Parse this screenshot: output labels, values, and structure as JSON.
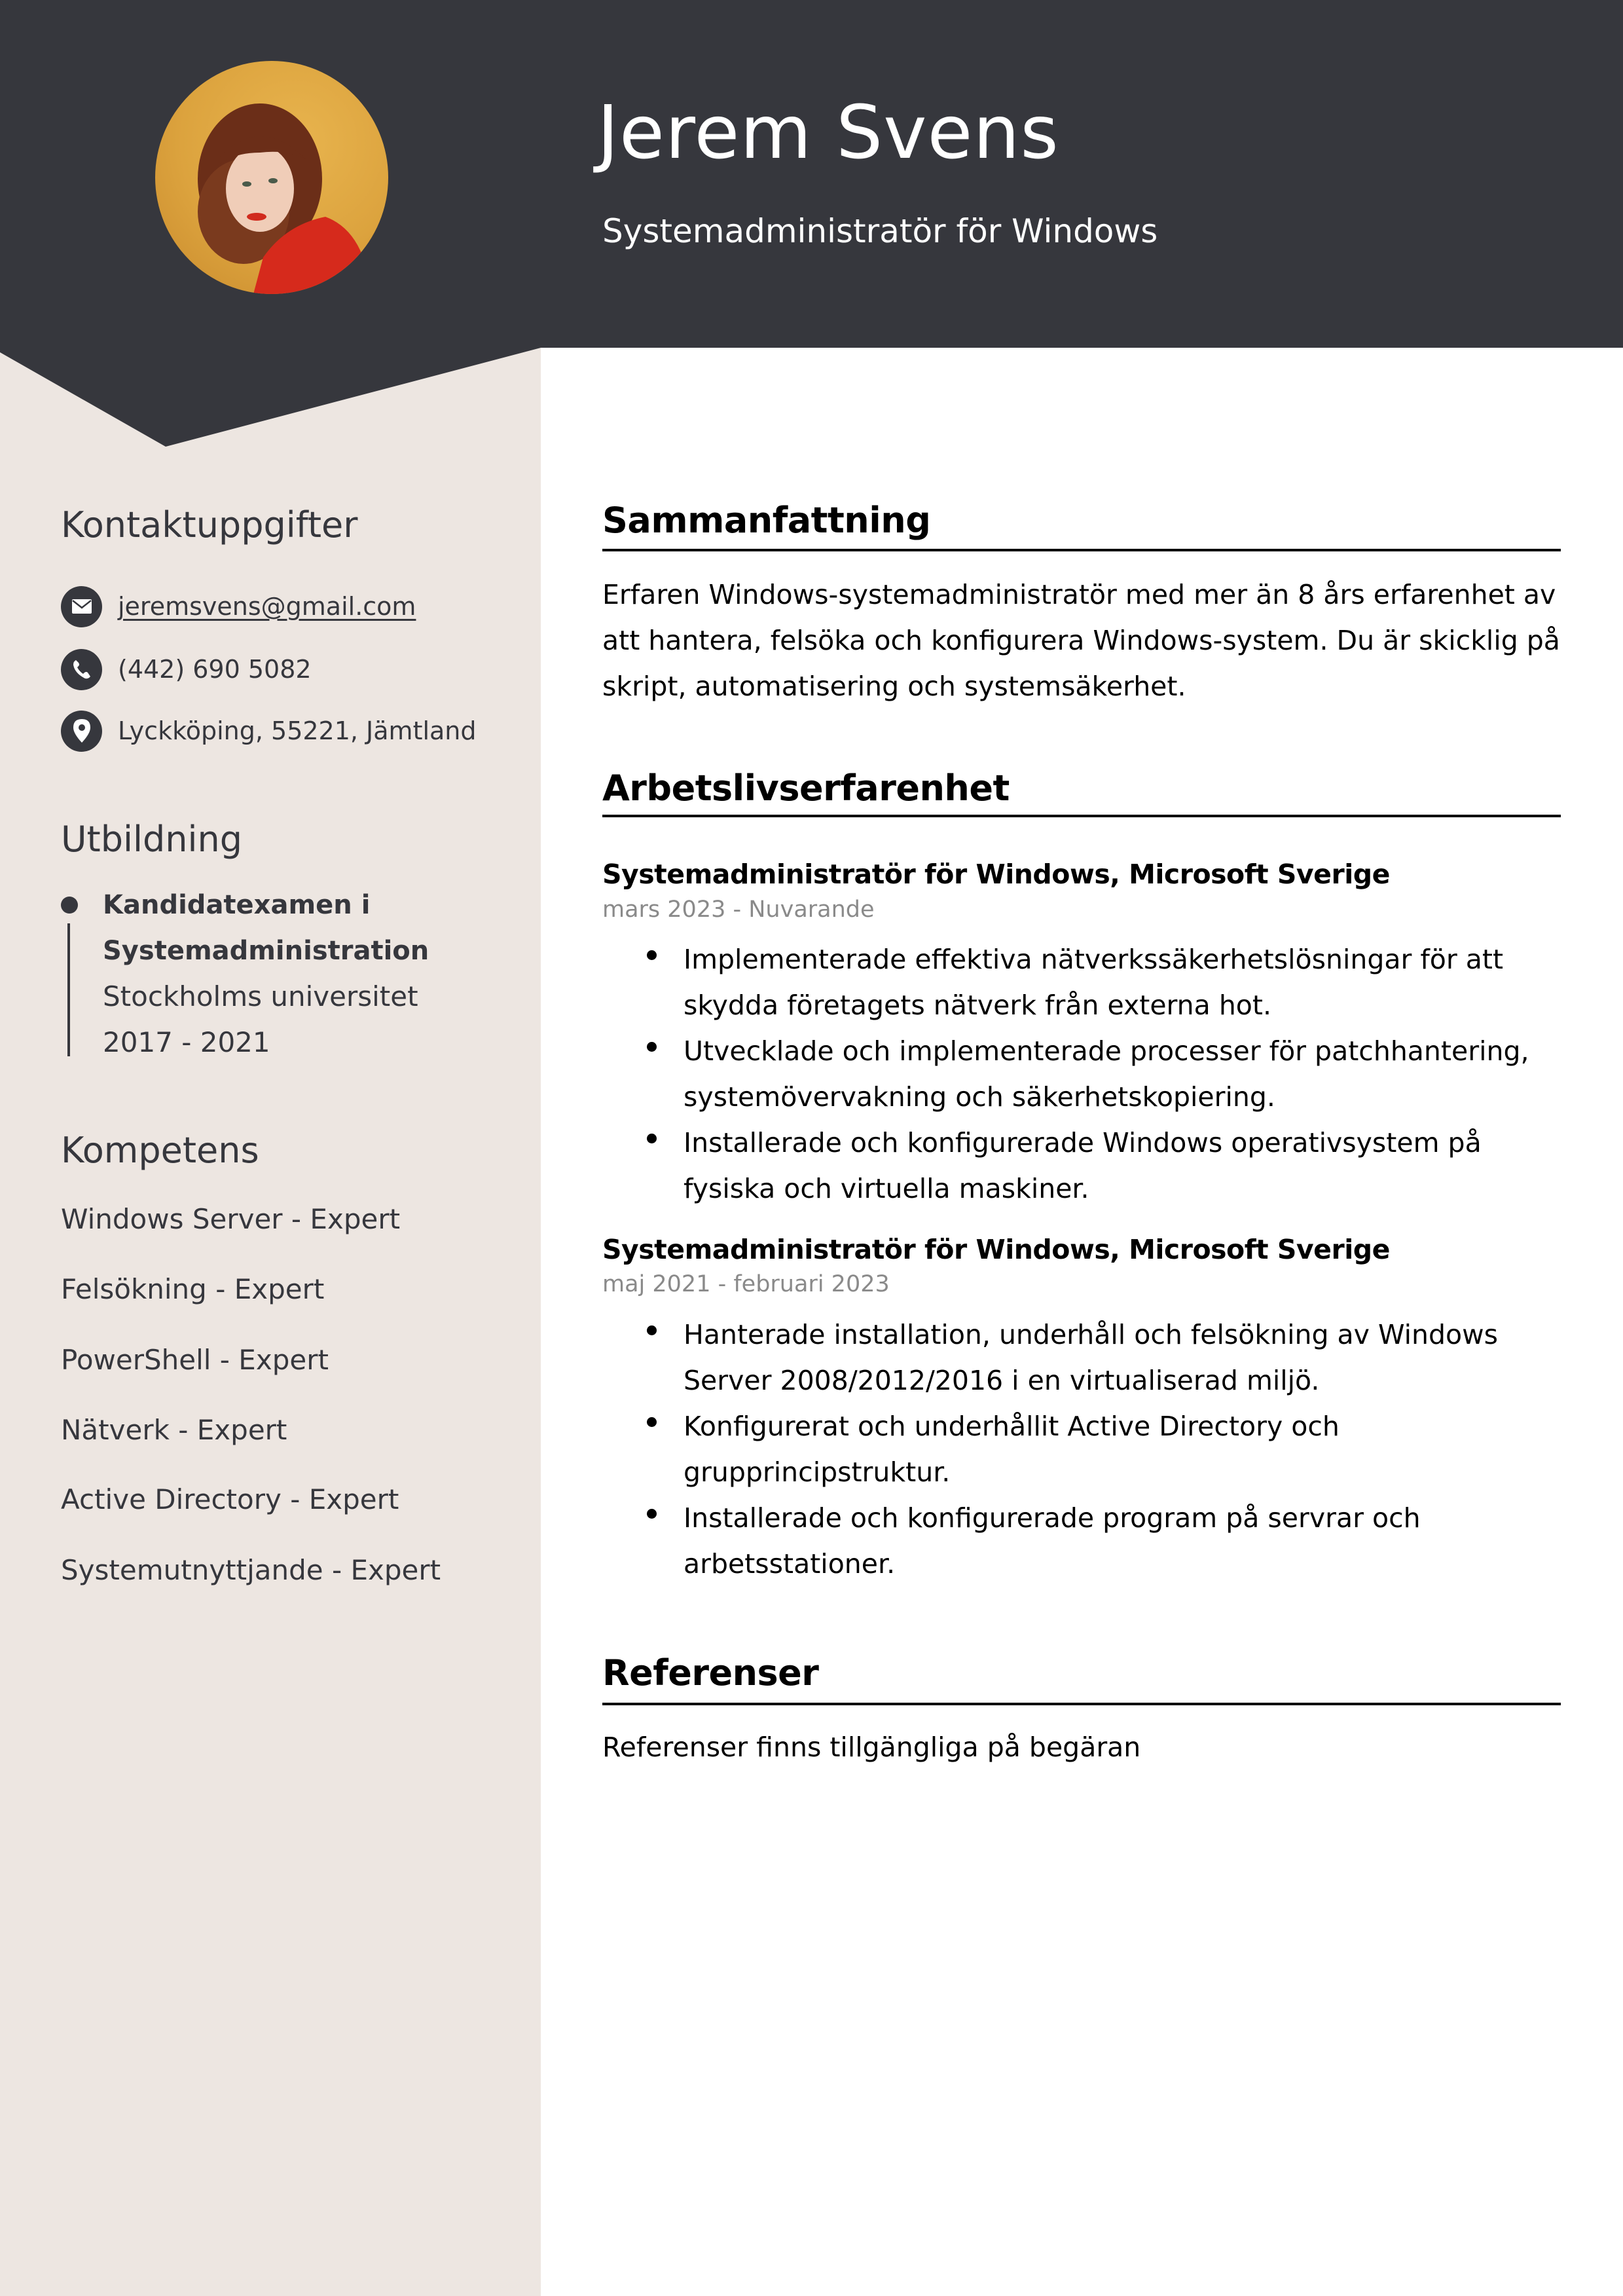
{
  "colors": {
    "header_bg": "#36373d",
    "sidebar_bg": "#ede6e1",
    "sidebar_text": "#36373d",
    "main_text": "#000000",
    "date_text": "#8a8a8a"
  },
  "header": {
    "name": "Jerem Svens",
    "title": "Systemadministratör för Windows",
    "photo_alt": "profile-photo"
  },
  "sidebar": {
    "contact": {
      "heading": "Kontaktuppgifter",
      "items": [
        {
          "icon": "envelope-icon",
          "text": "jeremsvens@gmail.com",
          "link": true
        },
        {
          "icon": "phone-icon",
          "text": "(442) 690 5082",
          "link": false
        },
        {
          "icon": "location-pin-icon",
          "text": "Lyckköping, 55221, Jämtland",
          "link": false
        }
      ]
    },
    "education": {
      "heading": "Utbildning",
      "entries": [
        {
          "degree_lines": [
            "Kandidatexamen i",
            "Systemadministration"
          ],
          "school": "Stockholms universitet",
          "years": "2017 - 2021"
        }
      ]
    },
    "skills": {
      "heading": "Kompetens",
      "items": [
        "Windows Server - Expert",
        "Felsökning - Expert",
        "PowerShell - Expert",
        "Nätverk - Expert",
        "Active Directory - Expert",
        "Systemutnyttjande - Expert"
      ]
    }
  },
  "main": {
    "summary": {
      "heading": "Sammanfattning",
      "lines": [
        "Erfaren Windows-systemadministratör med mer än 8 års erfarenhet av",
        "att hantera, felsöka och konfigurera Windows-system. Du är skicklig på",
        "skript, automatisering och systemsäkerhet."
      ]
    },
    "experience": {
      "heading": "Arbetslivserfarenhet",
      "jobs": [
        {
          "title": "Systemadministratör för Windows, Microsoft Sverige",
          "dates": "mars 2023 - Nuvarande",
          "bullets": [
            [
              "Implementerade effektiva nätverkssäkerhetslösningar för att",
              "skydda företagets nätverk från externa hot."
            ],
            [
              "Utvecklade och implementerade processer för patchhantering,",
              "systemövervakning och säkerhetskopiering."
            ],
            [
              "Installerade och konfigurerade Windows operativsystem på",
              "fysiska och virtuella maskiner."
            ]
          ]
        },
        {
          "title": "Systemadministratör för Windows, Microsoft Sverige",
          "dates": "maj 2021 - februari 2023",
          "bullets": [
            [
              "Hanterade installation, underhåll och felsökning av Windows",
              "Server 2008/2012/2016 i en virtualiserad miljö."
            ],
            [
              "Konfigurerat och underhållit Active Directory och",
              "grupprincipstruktur."
            ],
            [
              "Installerade och konfigurerade program på servrar och",
              "arbetsstationer."
            ]
          ]
        }
      ]
    },
    "references": {
      "heading": "Referenser",
      "text": "Referenser finns tillgängliga på begäran"
    }
  }
}
